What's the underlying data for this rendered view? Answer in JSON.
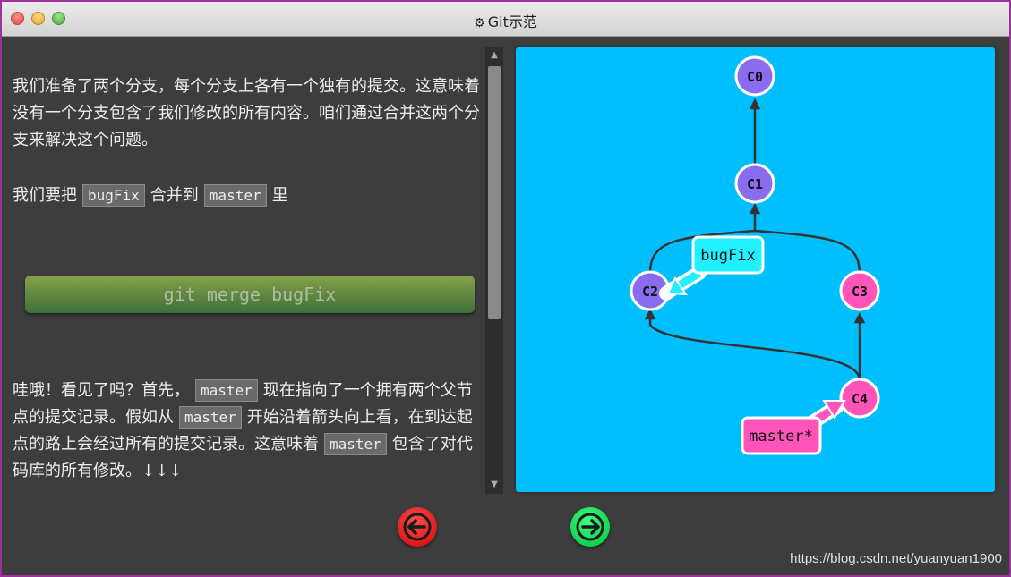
{
  "window": {
    "title": "Git示范",
    "title_icon": "gear-icon"
  },
  "lesson": {
    "para1": "我们准备了两个分支，每个分支上各有一个独有的提交。这意味着没有一个分支包含了我们修改的所有内容。咱们通过合并这两个分支来解决这个问题。",
    "para2_prefix": "我们要把",
    "para2_code1": "bugFix",
    "para2_middle": "合并到",
    "para2_code2": "master",
    "para2_suffix": "里",
    "command": "git merge bugFix",
    "para3_part1": "哇哦！看见了吗？首先，",
    "para3_code1": "master",
    "para3_part2": "现在指向了一个拥有两个父节点的提交记录。假如从",
    "para3_code2": "master",
    "para3_part3": "开始沿着箭头向上看，在到达起点的路上会经过所有的提交记录。这意味着",
    "para3_code3": "master",
    "para3_part4": "包含了对代码库的所有修改。↓↓↓"
  },
  "graph": {
    "background": "#00bfff",
    "commits": [
      {
        "id": "C0",
        "color": "#8a6cf0"
      },
      {
        "id": "C1",
        "color": "#8a6cf0"
      },
      {
        "id": "C2",
        "color": "#8a6cf0"
      },
      {
        "id": "C3",
        "color": "#ff55bb"
      },
      {
        "id": "C4",
        "color": "#ff55bb"
      }
    ],
    "branches": [
      {
        "name": "bugFix",
        "color": "#20f0ff",
        "target": "C2"
      },
      {
        "name": "master*",
        "color": "#ff55bb",
        "target": "C4"
      }
    ]
  },
  "nav": {
    "prev_icon": "arrow-left-icon",
    "next_icon": "arrow-right-icon"
  },
  "watermark": "https://blog.csdn.net/yuanyuan1900"
}
